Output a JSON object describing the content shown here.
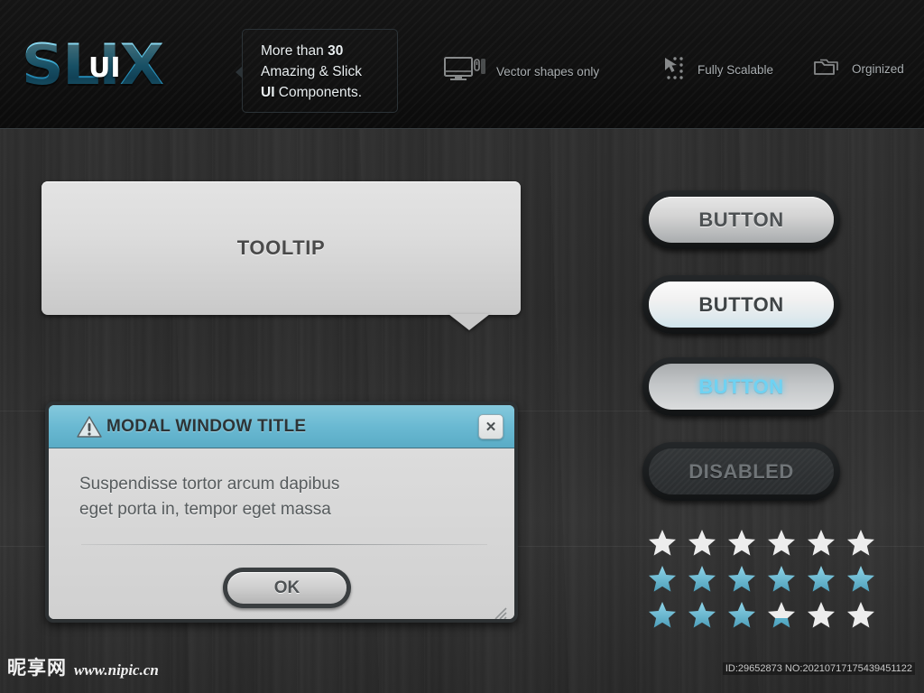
{
  "header": {
    "logo": {
      "main": "SLIX",
      "overlay": "UI"
    },
    "callout": {
      "line1_prefix": "More than ",
      "line1_bold": "30",
      "line2": "Amazing & Slick",
      "line3_bold": "UI",
      "line3_rest": " Components."
    },
    "features": [
      {
        "icon": "monitor-mouse-icon",
        "label": "Vector shapes only"
      },
      {
        "icon": "scale-handles-icon",
        "label": "Fully Scalable"
      },
      {
        "icon": "folders-icon",
        "label": "Orginized"
      }
    ]
  },
  "tooltip": {
    "label": "TOOLTIP"
  },
  "modal": {
    "title": "MODAL WINDOW TITLE",
    "warn_icon": "warning-triangle-icon",
    "close_label": "✕",
    "body_line1": "Suspendisse tortor arcum dapibus",
    "body_line2": "eget porta in, tempor eget massa",
    "ok_label": "OK",
    "resize_icon": "resize-grip-icon"
  },
  "buttons": [
    {
      "label": "BUTTON",
      "state": "normal"
    },
    {
      "label": "BUTTON",
      "state": "hover"
    },
    {
      "label": "BUTTON",
      "state": "active"
    },
    {
      "label": "DISABLED",
      "state": "disabled"
    }
  ],
  "star_ratings": [
    {
      "count": 6,
      "fills": [
        1,
        1,
        1,
        1,
        1,
        1
      ],
      "color": "white"
    },
    {
      "count": 6,
      "fills": [
        1,
        1,
        1,
        1,
        1,
        1
      ],
      "color": "cyan"
    },
    {
      "count": 6,
      "fills": [
        1,
        1,
        1,
        0.35,
        0,
        0
      ],
      "color": "cyan"
    }
  ],
  "colors": {
    "accent_cyan": "#6dcdea",
    "modal_titlebar": "#6ab9d2",
    "background": "#2e2e2e",
    "header_background": "#101010",
    "star_white": "#ededed",
    "star_cyan": "#5fb8d4"
  },
  "footer": {
    "watermark_cn": "昵享网",
    "watermark_url": "www.nipic.cn",
    "id_text": "ID:29652873 NO:20210717175439451122"
  }
}
